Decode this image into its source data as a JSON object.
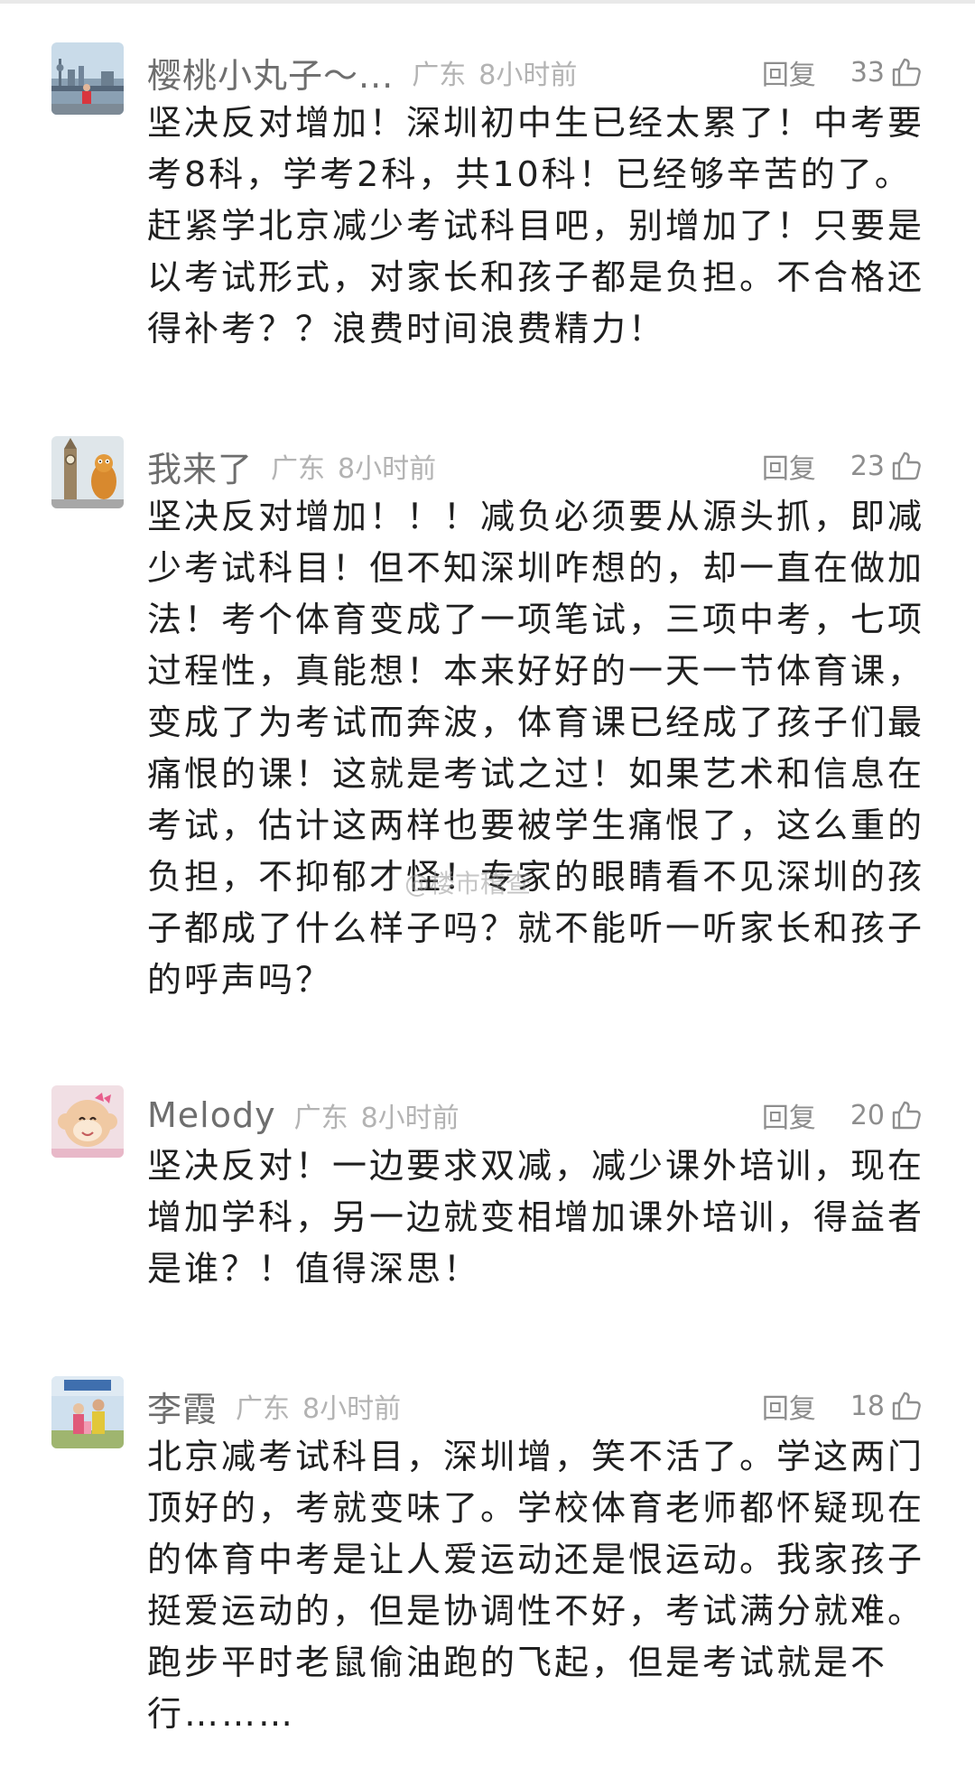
{
  "watermark": "@楼市稽查",
  "comments": [
    {
      "username": "樱桃小丸子～...",
      "region": "广东",
      "time": "8小时前",
      "reply_label": "回复",
      "likes": "33",
      "text": "坚决反对增加！深圳初中生已经太累了！中考要考8科，学考2科，共10科！已经够辛苦的了。赶紧学北京减少考试科目吧，别增加了！只要是以考试形式，对家长和孩子都是负担。不合格还得补考？？浪费时间浪费精力！"
    },
    {
      "username": "我来了",
      "region": "广东",
      "time": "8小时前",
      "reply_label": "回复",
      "likes": "23",
      "text": "坚决反对增加！！！减负必须要从源头抓，即减少考试科目！但不知深圳咋想的，却一直在做加法！考个体育变成了一项笔试，三项中考，七项过程性，真能想！本来好好的一天一节体育课，变成了为考试而奔波，体育课已经成了孩子们最痛恨的课！这就是考试之过！如果艺术和信息在考试，估计这两样也要被学生痛恨了，这么重的负担，不抑郁才怪！专家的眼睛看不见深圳的孩子都成了什么样子吗？就不能听一听家长和孩子的呼声吗？"
    },
    {
      "username": "Melody",
      "region": "广东",
      "time": "8小时前",
      "reply_label": "回复",
      "likes": "20",
      "text": "坚决反对！一边要求双减，减少课外培训，现在增加学科，另一边就变相增加课外培训，得益者是谁？！值得深思！"
    },
    {
      "username": "李霞",
      "region": "广东",
      "time": "8小时前",
      "reply_label": "回复",
      "likes": "18",
      "text": "北京减考试科目，深圳增，笑不活了。学这两门顶好的，考就变味了。学校体育老师都怀疑现在的体育中考是让人爱运动还是恨运动。我家孩子挺爱运动的，但是协调性不好，考试满分就难。跑步平时老鼠偷油跑的飞起，但是考试就是不行………"
    }
  ]
}
